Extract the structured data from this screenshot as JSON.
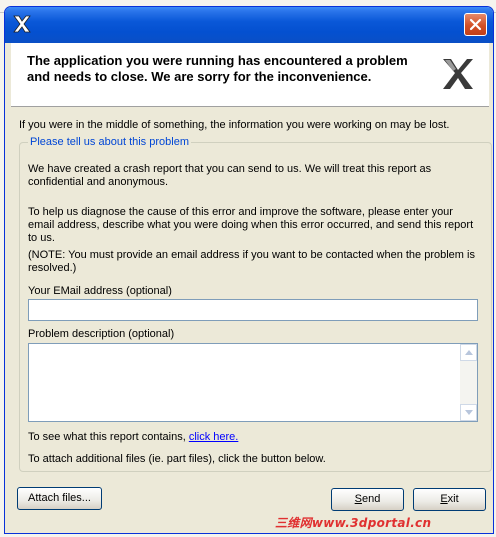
{
  "header": {
    "message": "The application you were running has encountered a problem and needs to close.  We are sorry for the inconvenience."
  },
  "lost_notice": "If you were in the middle of something, the information you were working on may be lost.",
  "group": {
    "label": "Please tell us about this problem",
    "intro": "We have created a crash report that you can send to us.  We will treat this report as confidential and anonymous.",
    "help": "To help us diagnose the cause of this error and improve the software, please enter your email address, describe what you were doing when this error occurred, and send this report to us.",
    "note": "(NOTE: You must provide an email address if you want to be contacted when the problem is resolved.)",
    "email_label": "Your EMail address (optional)",
    "email_value": "",
    "description_label": "Problem description (optional)",
    "description_value": "",
    "contains_prefix": "To see what this report contains,",
    "contains_link": "click here.",
    "attach_text": "To attach additional files (ie. part files), click the button below."
  },
  "buttons": {
    "attach": "Attach files...",
    "send_first": "S",
    "send_rest": "end",
    "exit_first": "E",
    "exit_rest": "xit"
  },
  "watermark": "三维网www.3dportal.cn",
  "icons": {
    "title_icon": "app-logo-icon",
    "close": "close-icon",
    "header_logo": "app-logo-icon",
    "scroll_up": "scroll-up-arrow-icon",
    "scroll_down": "scroll-down-arrow-icon"
  },
  "colors": {
    "titlebar": "#0450d0",
    "group_label": "#0046d5",
    "link": "#0000ff",
    "close_button": "#d35026"
  }
}
